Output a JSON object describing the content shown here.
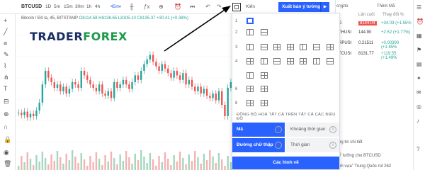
{
  "header": {
    "symbol": "BTCUSD",
    "timeframes": [
      "1D",
      "5m",
      "15m",
      "30m",
      "1h",
      "4h",
      "1D",
      "45m"
    ],
    "active_timeframe": "45m",
    "layout_label": "Kiến",
    "publish_label": "Xuất bản ý tưởng",
    "play_icon": "play-icon"
  },
  "chart_info": {
    "title": "Bitcoin / Đô la",
    "interval": "45",
    "exchange": "BITSTAMP",
    "ohlc": "O8114.58 H8136.65 L8105.10 C8135.37 +30.41 (+0.38%)"
  },
  "logo": {
    "text_a": "TRADER",
    "text_b": "FOREX"
  },
  "watchlist": {
    "search": "crypto",
    "tab": "Thêm Mã",
    "col_last": "Lần cuối",
    "col_change": "Thay đổi %",
    "rows": [
      {
        "sym": "D",
        "last": "8144.04",
        "chg": "+34.03 (+1.55%",
        "hl": true
      },
      {
        "sym": "THUSI",
        "last": "144.90",
        "chg": "+2.52 (+1.77%)",
        "hl": false
      },
      {
        "sym": "RPUSI",
        "last": "0.21511",
        "chg": "+0.00390 (+1.85%",
        "hl": false
      },
      {
        "sym": "TCUSI",
        "last": "8131.77",
        "chg": "+119.55 (+1.49%",
        "hl": false
      }
    ],
    "news_label": "ng tin chi tiết",
    "idea_label": "Ý tưởng cho BTCUSD",
    "headline": "nh vựa\" Trung Quốc rút 262"
  },
  "layout_menu": {
    "row_labels": [
      "1",
      "2",
      "3",
      "4",
      "6",
      "8"
    ],
    "sync_label": "ĐỒNG BỘ HOÁ TẤT CẢ TRÊN TẤT CẢ CÁC BIỂU ĐỒ",
    "options": [
      {
        "label": "Mã",
        "style": "blue"
      },
      {
        "label": "Khoảng thời gian",
        "style": "gray"
      },
      {
        "label": "Đường chữ thập",
        "style": "blue"
      },
      {
        "label": "Thời gian",
        "style": "gray"
      }
    ],
    "info_glyph": "i",
    "all_drawings": "Các hình vẽ"
  },
  "colors": {
    "accent": "#2962ff",
    "up": "#26a69a",
    "down": "#ef5350",
    "logo_green": "#1e9a4b",
    "logo_navy": "#1a2e64"
  },
  "chart_data": {
    "type": "line",
    "series": [
      {
        "values": [
          33,
          31,
          34,
          29,
          32,
          30,
          35,
          42,
          58,
          70,
          64,
          60,
          55,
          58,
          52,
          56,
          50,
          54,
          60,
          58,
          55,
          70,
          66,
          62,
          58,
          55,
          52,
          58,
          50,
          48,
          52,
          46,
          60,
          55,
          58,
          62,
          58,
          54,
          60,
          66,
          62,
          70,
          76,
          80,
          84,
          78,
          74,
          70,
          76,
          72,
          68,
          64,
          70,
          66,
          62,
          68,
          58,
          62,
          56,
          52,
          56,
          50,
          54,
          48,
          46,
          50,
          44,
          52,
          40,
          30,
          55,
          60
        ]
      }
    ]
  }
}
